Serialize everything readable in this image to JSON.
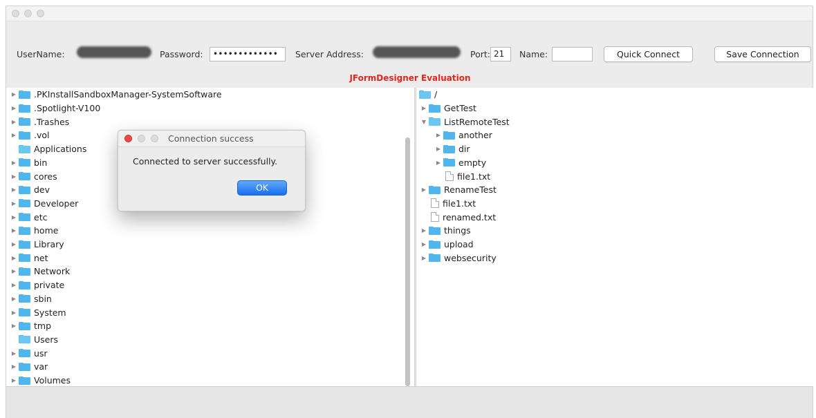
{
  "toolbar": {
    "username_label": "UserName:",
    "password_label": "Password:",
    "password_value": "•••••••••••••",
    "server_address_label": "Server Address:",
    "port_label": "Port:",
    "port_value": "21",
    "name_label": "Name:",
    "name_value": "",
    "quick_connect_label": "Quick Connect",
    "save_connection_label": "Save Connection",
    "evaluation_banner": "JFormDesigner Evaluation"
  },
  "local_tree": {
    "items": [
      {
        "label": ".PKInstallSandboxManager-SystemSoftware",
        "expandable": true
      },
      {
        "label": ".Spotlight-V100",
        "expandable": true
      },
      {
        "label": ".Trashes",
        "expandable": true
      },
      {
        "label": ".vol",
        "expandable": true
      },
      {
        "label": "Applications",
        "expandable": false
      },
      {
        "label": "bin",
        "expandable": true
      },
      {
        "label": "cores",
        "expandable": true
      },
      {
        "label": "dev",
        "expandable": true
      },
      {
        "label": "Developer",
        "expandable": true
      },
      {
        "label": "etc",
        "expandable": true
      },
      {
        "label": "home",
        "expandable": true
      },
      {
        "label": "Library",
        "expandable": true
      },
      {
        "label": "net",
        "expandable": true
      },
      {
        "label": "Network",
        "expandable": true
      },
      {
        "label": "private",
        "expandable": true
      },
      {
        "label": "sbin",
        "expandable": true
      },
      {
        "label": "System",
        "expandable": true
      },
      {
        "label": "tmp",
        "expandable": true
      },
      {
        "label": "Users",
        "expandable": false
      },
      {
        "label": "usr",
        "expandable": true
      },
      {
        "label": "var",
        "expandable": true
      },
      {
        "label": "Volumes",
        "expandable": true
      }
    ]
  },
  "remote_tree": {
    "items": [
      {
        "label": "/",
        "type": "folder-open",
        "depth": 0,
        "arrow": ""
      },
      {
        "label": "GetTest",
        "type": "folder",
        "depth": 1,
        "arrow": "collapsed"
      },
      {
        "label": "ListRemoteTest",
        "type": "folder-open",
        "depth": 1,
        "arrow": "expanded"
      },
      {
        "label": "another",
        "type": "folder",
        "depth": 2,
        "arrow": "collapsed"
      },
      {
        "label": "dir",
        "type": "folder",
        "depth": 2,
        "arrow": "collapsed"
      },
      {
        "label": "empty",
        "type": "folder",
        "depth": 2,
        "arrow": "collapsed"
      },
      {
        "label": "file1.txt",
        "type": "file",
        "depth": 2,
        "arrow": ""
      },
      {
        "label": "RenameTest",
        "type": "folder",
        "depth": 1,
        "arrow": "collapsed"
      },
      {
        "label": "file1.txt",
        "type": "file",
        "depth": 1,
        "arrow": ""
      },
      {
        "label": "renamed.txt",
        "type": "file",
        "depth": 1,
        "arrow": ""
      },
      {
        "label": "things",
        "type": "folder",
        "depth": 1,
        "arrow": "collapsed"
      },
      {
        "label": "upload",
        "type": "folder",
        "depth": 1,
        "arrow": "collapsed"
      },
      {
        "label": "websecurity",
        "type": "folder",
        "depth": 1,
        "arrow": "collapsed"
      }
    ]
  },
  "dialog": {
    "title": "Connection success",
    "message": "Connected to server successfully.",
    "ok_label": "OK"
  },
  "colors": {
    "folder": "#4fb6ee",
    "evaluation_red": "#e3261c",
    "ok_button_blue": "#1a6ff0",
    "close_red": "#ee4a42"
  }
}
